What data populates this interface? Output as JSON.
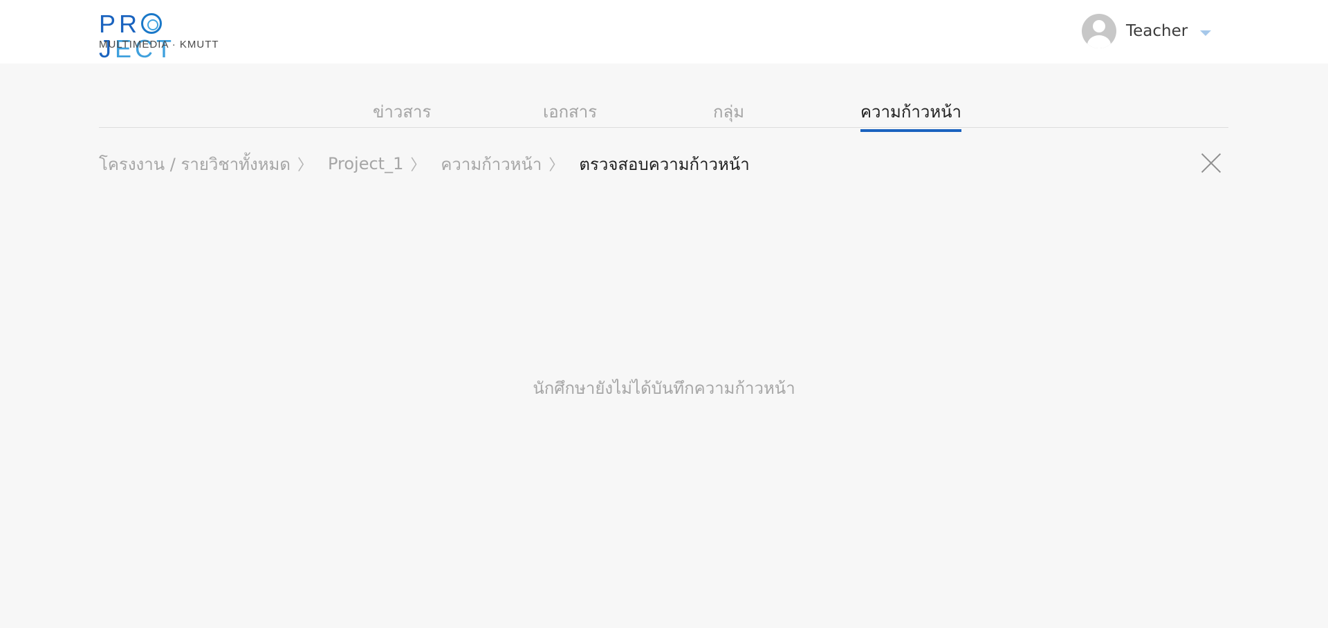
{
  "logo": {
    "word_head": "PR",
    "word_mid": "J",
    "word_tail": "ECT",
    "subtitle": "MULTIMEDIA · KMUTT"
  },
  "user": {
    "name": "Teacher",
    "avatar_icon": "user-avatar-icon",
    "caret_icon": "chevron-down-icon"
  },
  "tabs": [
    {
      "label": "ข่าวสาร",
      "active": false
    },
    {
      "label": "เอกสาร",
      "active": false
    },
    {
      "label": "กลุ่ม",
      "active": false
    },
    {
      "label": "ความก้าวหน้า",
      "active": true
    }
  ],
  "breadcrumb": {
    "items": [
      {
        "label": "โครงงาน / รายวิชาทั้งหมด",
        "separator": "〉"
      },
      {
        "label": "Project_1",
        "separator": "〉"
      },
      {
        "label": "ความก้าวหน้า",
        "separator": "〉"
      },
      {
        "label": "ตรวจสอบความก้าวหน้า"
      }
    ]
  },
  "close_icon": "close-icon",
  "empty_message": "นักศึกษายังไม่ได้บันทึกความก้าวหน้า",
  "colors": {
    "brand": "#1a63bf",
    "active_tab_underline": "#1a63bf",
    "muted_text": "#a6a6a6",
    "background": "#f7f7f7"
  }
}
